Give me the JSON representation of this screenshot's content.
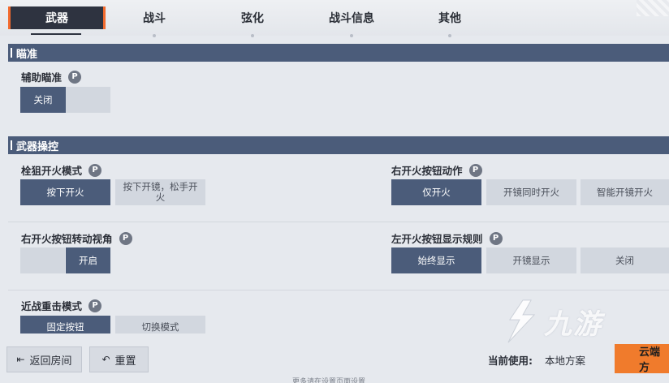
{
  "tabs": [
    {
      "label": "武器",
      "active": true
    },
    {
      "label": "战斗",
      "active": false
    },
    {
      "label": "弦化",
      "active": false
    },
    {
      "label": "战斗信息",
      "active": false
    },
    {
      "label": "其他",
      "active": false
    }
  ],
  "sections": {
    "aim": {
      "title": "瞄准",
      "assist_aim": {
        "label": "辅助瞄准",
        "options": [
          "关闭",
          ""
        ],
        "selected": "关闭"
      }
    },
    "weapon": {
      "title": "武器操控",
      "sniper_fire_mode": {
        "label": "栓狙开火模式",
        "options": [
          "按下开火",
          "按下开镜，松手开火"
        ],
        "selected": "按下开火"
      },
      "right_fire_action": {
        "label": "右开火按钮动作",
        "options": [
          "仅开火",
          "开镜同时开火",
          "智能开镜开火"
        ],
        "selected": "仅开火"
      },
      "right_fire_rotate": {
        "label": "右开火按钮转动视角",
        "options": [
          "",
          "开启"
        ],
        "selected": "开启"
      },
      "left_fire_display": {
        "label": "左开火按钮显示规则",
        "options": [
          "始终显示",
          "开镜显示",
          "关闭"
        ],
        "selected": "始终显示"
      },
      "melee_heavy": {
        "label": "近战重击模式",
        "options": [
          "固定按钮",
          "切换模式"
        ],
        "selected": "固定按钮"
      }
    }
  },
  "help_glyph": "P",
  "bottom": {
    "back_label": "返回房间",
    "reset_label": "重置",
    "current_scheme_label": "当前使用:",
    "current_scheme_value": "本地方案",
    "cloud_label": "云端方",
    "hint": "更多请在设置页面设置"
  },
  "watermark": {
    "text": "九游"
  },
  "colors": {
    "accent": "#f26a2e",
    "selected": "#4b5c7a",
    "option_bg": "#d2d7df",
    "cloud_button": "#f07b2c"
  },
  "icons": {
    "back": "exit-icon",
    "reset": "undo-icon",
    "help": "help-icon"
  }
}
